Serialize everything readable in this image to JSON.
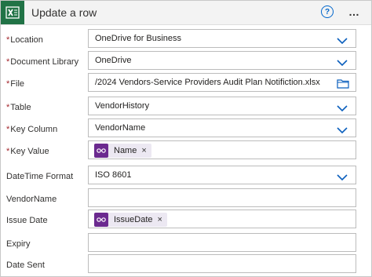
{
  "header": {
    "title": "Update a row",
    "help_icon": "?"
  },
  "fields": [
    {
      "label": "Location",
      "required": true,
      "value": "OneDrive for Business",
      "control": "dropdown"
    },
    {
      "label": "Document Library",
      "required": true,
      "value": "OneDrive",
      "control": "dropdown"
    },
    {
      "label": "File",
      "required": true,
      "value": "/2024 Vendors-Service Providers Audit Plan Notifiction.xlsx",
      "control": "file"
    },
    {
      "label": "Table",
      "required": true,
      "value": "VendorHistory",
      "control": "dropdown"
    },
    {
      "label": "Key Column",
      "required": true,
      "value": "VendorName",
      "control": "dropdown"
    },
    {
      "label": "Key Value",
      "required": true,
      "token": "Name",
      "control": "token"
    },
    {
      "label": "DateTime Format",
      "required": false,
      "value": "ISO 8601",
      "control": "dropdown"
    },
    {
      "label": "VendorName",
      "required": false,
      "value": "",
      "control": "text"
    },
    {
      "label": "Issue Date",
      "required": false,
      "token": "IssueDate",
      "control": "token"
    },
    {
      "label": "Expiry",
      "required": false,
      "value": "",
      "control": "text"
    },
    {
      "label": "Date Sent",
      "required": false,
      "value": "",
      "control": "text"
    }
  ],
  "required_marker": "*",
  "token_remove": "×",
  "colors": {
    "excel": "#217346",
    "token_icon": "#6b2a8f",
    "accent": "#0066cc",
    "required": "#a4262c"
  }
}
